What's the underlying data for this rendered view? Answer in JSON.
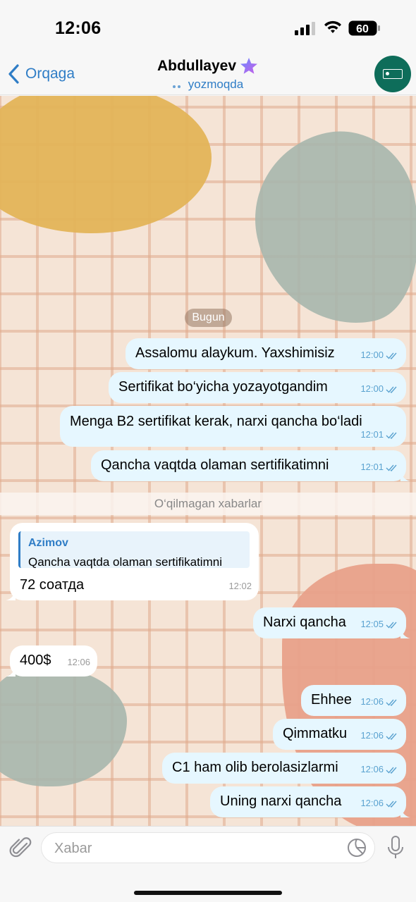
{
  "status_bar": {
    "time": "12:06",
    "battery": "60"
  },
  "header": {
    "back_label": "Orqaga",
    "contact_name": "Abdullayev",
    "typing_status": "yozmoqda"
  },
  "chat": {
    "date_label": "Bugun",
    "unread_label": "O‘qilmagan xabarlar",
    "messages_before": [
      {
        "text": "Assalomu alaykum. Yaxshimisiz",
        "time": "12:00"
      },
      {
        "text": "Sertifikat bo‘yicha yozayotgandim",
        "time": "12:00"
      },
      {
        "text": "Menga B2 sertifikat kerak, narxi qancha bo‘ladi",
        "time": "12:01"
      },
      {
        "text": "Qancha vaqtda olaman sertifikatimni",
        "time": "12:01"
      }
    ],
    "reply_message": {
      "reply_name": "Azimov",
      "reply_text": "Qancha vaqtda olaman sertifikatimni",
      "text": "72 соатда",
      "time": "12:02"
    },
    "messages_after": [
      {
        "text": "Narxi qancha",
        "time": "12:05",
        "direction": "out"
      },
      {
        "text": "400$",
        "time": "12:06",
        "direction": "in"
      },
      {
        "text": "Ehhee",
        "time": "12:06",
        "direction": "out"
      },
      {
        "text": "Qimmatku",
        "time": "12:06",
        "direction": "out"
      },
      {
        "text": "C1 ham olib berolasizlarmi",
        "time": "12:06",
        "direction": "out"
      },
      {
        "text": "Uning narxi qancha",
        "time": "12:06",
        "direction": "out"
      }
    ]
  },
  "input": {
    "placeholder": "Xabar"
  },
  "colors": {
    "accent": "#2f7dc6",
    "out_bubble": "#e6f7ff",
    "in_bubble": "#ffffff"
  }
}
